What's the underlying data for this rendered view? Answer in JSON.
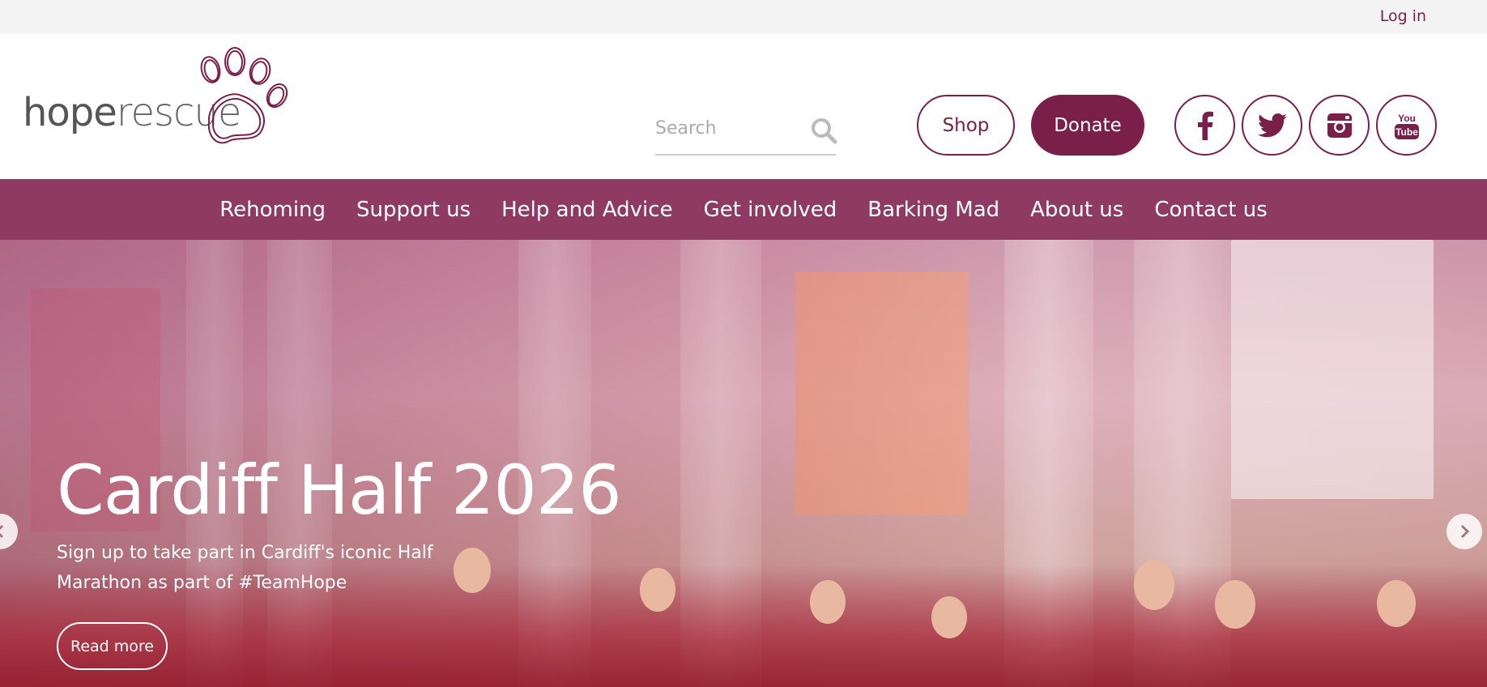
{
  "topbar": {
    "login_label": "Log in"
  },
  "logo": {
    "text_bold": "hope",
    "text_light": "rescue"
  },
  "search": {
    "placeholder": "Search"
  },
  "header": {
    "shop_label": "Shop",
    "donate_label": "Donate"
  },
  "social": [
    {
      "icon": "facebook-icon"
    },
    {
      "icon": "twitter-icon"
    },
    {
      "icon": "instagram-icon"
    },
    {
      "icon": "youtube-icon",
      "label_top": "You",
      "label_bottom": "Tube"
    }
  ],
  "nav": {
    "items": [
      "Rehoming",
      "Support us",
      "Help and Advice",
      "Get involved",
      "Barking Mad",
      "About us",
      "Contact us"
    ]
  },
  "hero": {
    "title": "Cardiff Half 2026",
    "subtitle": "Sign up to take part in Cardiff's iconic Half Marathon as part of #TeamHope",
    "read_more_label": "Read more"
  },
  "colors": {
    "brand": "#7a1f4a",
    "nav": "#8e3a62",
    "topbar": "#f4f4f4"
  }
}
